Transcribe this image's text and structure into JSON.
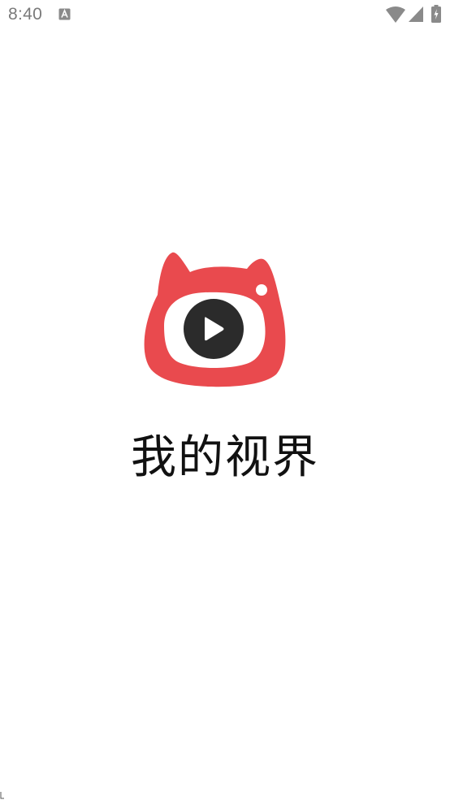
{
  "status_bar": {
    "time": "8:40",
    "icons": [
      "text-notification-icon",
      "wifi-icon",
      "cellular-signal-icon",
      "battery-charging-icon"
    ]
  },
  "splash": {
    "logo_icon": "cat-camera-play-icon",
    "app_name": "我的视界"
  },
  "colors": {
    "background": "#ffffff",
    "brand_red": "#e94a4e",
    "play_circle": "#2b2b2b",
    "status_icons": "#8a8a8a",
    "app_name_text": "#111111"
  }
}
